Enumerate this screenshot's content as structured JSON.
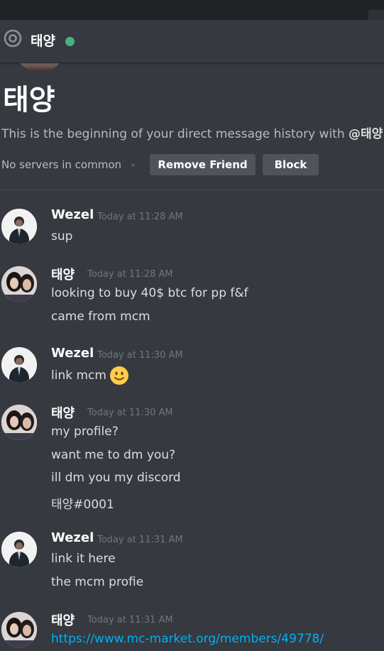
{
  "header": {
    "name": "태양",
    "status_color": "#43b581",
    "icon": "at-icon"
  },
  "intro": {
    "name": "태양",
    "text_prefix": "This is the beginning of your direct message history with ",
    "mention": "@태양",
    "text_suffix": ".",
    "servers": "No servers in common",
    "remove_friend": "Remove Friend",
    "block": "Block"
  },
  "messages": [
    {
      "author": "Wezel",
      "time": "Today at 11:28 AM",
      "lines": [
        "sup"
      ]
    },
    {
      "author": "태양",
      "time": "Today at 11:28 AM",
      "lines": [
        "looking to buy 40$ btc for pp f&f",
        "came from mcm"
      ]
    },
    {
      "author": "Wezel",
      "time": "Today at 11:30 AM",
      "lines": [
        "link mcm"
      ],
      "emoji": "slightly-smiling-face-icon"
    },
    {
      "author": "태양",
      "time": "Today at 11:30 AM",
      "lines": [
        "my profile?",
        "want me to dm you?",
        "ill dm you my discord",
        "태양#0001"
      ]
    },
    {
      "author": "Wezel",
      "time": "Today at 11:31 AM",
      "lines": [
        "link it here",
        "the mcm profie"
      ]
    },
    {
      "author": "태양",
      "time": "Today at 11:31 AM",
      "lines": [
        "https://www.mc-market.org/members/49778/"
      ]
    }
  ]
}
